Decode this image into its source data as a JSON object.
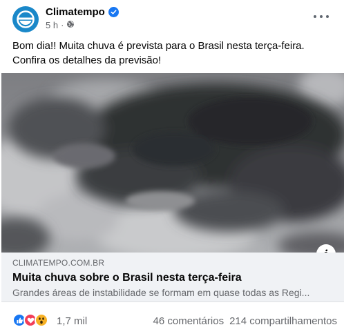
{
  "page": {
    "name": "Climatempo",
    "time": "5 h",
    "separator": "·"
  },
  "post": {
    "caption_line1": "Bom dia!! Muita chuva é prevista para o Brasil nesta terça-feira.",
    "caption_line2": "Confira os detalhes da previsão!"
  },
  "link": {
    "domain": "CLIMATEMPO.COM.BR",
    "title": "Muita chuva sobre o Brasil nesta terça-feira",
    "description": "Grandes áreas de instabilidade se formam em quase todas as Regi..."
  },
  "info_label": "i",
  "footer": {
    "reaction_count": "1,7 mil",
    "comments": "46 comentários",
    "shares": "214 compartilhamentos"
  },
  "colors": {
    "brand_blue": "#1a88c9",
    "verified_blue": "#1877f2",
    "secondary_text": "#65676b"
  },
  "icons": {
    "avatar": "climatempo-logo",
    "verified": "verified-badge-icon",
    "privacy": "globe-icon",
    "more": "more-options-icon",
    "info": "info-icon",
    "reactions": [
      "like-icon",
      "love-icon",
      "wow-icon"
    ]
  }
}
